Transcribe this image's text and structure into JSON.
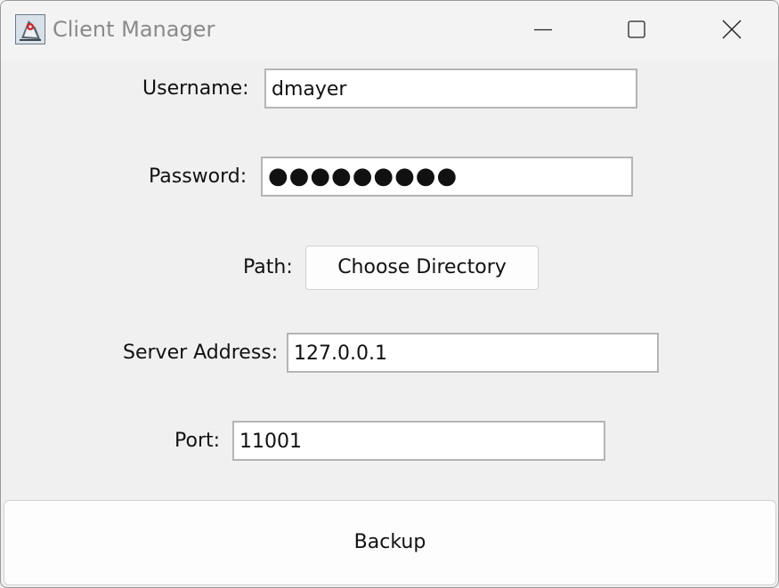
{
  "window": {
    "title": "Client Manager",
    "icon": "java-app-icon",
    "controls": [
      "minimize-icon",
      "maximize-icon",
      "close-icon"
    ]
  },
  "form": {
    "username": {
      "label": "Username:",
      "value": "dmayer"
    },
    "password": {
      "label": "Password:",
      "value": "●●●●●●●●●"
    },
    "path": {
      "label": "Path:",
      "button_label": "Choose Directory"
    },
    "server_address": {
      "label": "Server Address:",
      "value": "127.0.0.1"
    },
    "port": {
      "label": "Port:",
      "value": "11001"
    }
  },
  "actions": {
    "backup_label": "Backup"
  }
}
